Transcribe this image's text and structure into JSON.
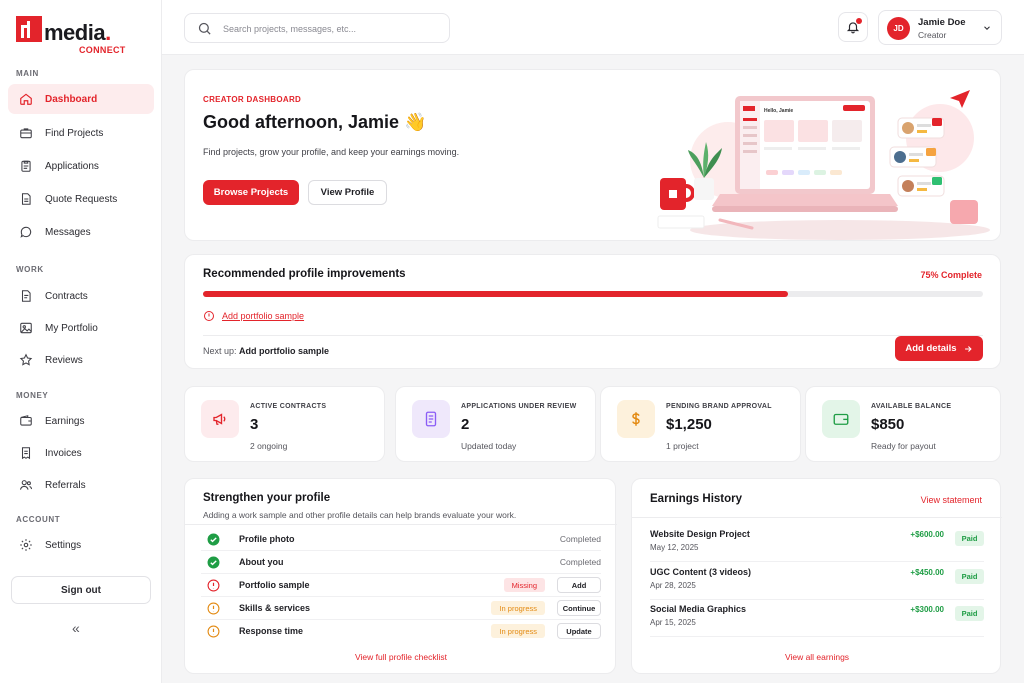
{
  "brand": {
    "name": "media",
    "dot": ".",
    "sub": "CONNECT",
    "accent": "#e3242b"
  },
  "sidebar": {
    "sections": {
      "main": "MAIN",
      "work": "WORK",
      "money": "MONEY",
      "account": "ACCOUNT"
    },
    "items": [
      {
        "label": "Dashboard",
        "icon": "home-icon"
      },
      {
        "label": "Find Projects",
        "icon": "briefcase-icon"
      },
      {
        "label": "Applications",
        "icon": "clipboard-icon"
      },
      {
        "label": "Quote Requests",
        "icon": "document-icon"
      },
      {
        "label": "Messages",
        "icon": "chat-icon"
      },
      {
        "label": "Contracts",
        "icon": "contract-icon"
      },
      {
        "label": "My Portfolio",
        "icon": "image-icon"
      },
      {
        "label": "Reviews",
        "icon": "star-icon"
      },
      {
        "label": "Earnings",
        "icon": "wallet-icon"
      },
      {
        "label": "Invoices",
        "icon": "invoice-icon"
      },
      {
        "label": "Referrals",
        "icon": "users-icon"
      },
      {
        "label": "Settings",
        "icon": "gear-icon"
      }
    ],
    "signout": "Sign out",
    "collapse": "«"
  },
  "header": {
    "search_placeholder": "Search projects, messages, etc...",
    "user": {
      "initials": "JD",
      "name": "Jamie Doe",
      "role": "Creator"
    }
  },
  "hero": {
    "eyebrow": "CREATOR DASHBOARD",
    "greeting": "Good afternoon, Jamie 👋",
    "description": "Find projects, grow your profile, and keep your earnings moving.",
    "primary_button": "Browse Projects",
    "secondary_button": "View Profile",
    "screen_greeting": "Hello, Jamie"
  },
  "improvements": {
    "title": "Recommended profile improvements",
    "percent_label": "75% Complete",
    "progress": 0.75,
    "link": "Add portfolio sample",
    "next_prefix": "Next up:",
    "next_value": "Add portfolio sample",
    "button": "Add details"
  },
  "stats": [
    {
      "label": "ACTIVE CONTRACTS",
      "value": "3",
      "sub": "2 ongoing",
      "icon": "megaphone-icon",
      "bg": "#fdebed",
      "color": "#e3242b"
    },
    {
      "label": "APPLICATIONS UNDER REVIEW",
      "value": "2",
      "sub": "Updated today",
      "icon": "file-list-icon",
      "bg": "#efe8fb",
      "color": "#8b5cf6"
    },
    {
      "label": "PENDING BRAND APPROVAL",
      "value": "$1,250",
      "sub": "1 project",
      "icon": "dollar-icon",
      "bg": "#fdf1dc",
      "color": "#e38a12"
    },
    {
      "label": "AVAILABLE BALANCE",
      "value": "$850",
      "sub": "Ready for payout",
      "icon": "wallet-icon",
      "bg": "#e3f5e8",
      "color": "#1f9d45"
    }
  ],
  "strengthen": {
    "title": "Strengthen your profile",
    "subtitle": "Adding a work sample and other profile details can help brands evaluate your work.",
    "rows": [
      {
        "label": "Profile photo",
        "status": "Completed",
        "state": "done"
      },
      {
        "label": "About you",
        "status": "Completed",
        "state": "done"
      },
      {
        "label": "Portfolio sample",
        "status": "Missing",
        "state": "missing",
        "action": "Add"
      },
      {
        "label": "Skills & services",
        "status": "In progress",
        "state": "progress",
        "action": "Continue"
      },
      {
        "label": "Response time",
        "status": "In progress",
        "state": "progress",
        "action": "Update"
      }
    ],
    "footer": "View full profile checklist"
  },
  "earnings": {
    "title": "Earnings History",
    "link": "View statement",
    "rows": [
      {
        "name": "Website Design Project",
        "date": "May 12, 2025",
        "amount": "+$600.00",
        "status": "Paid"
      },
      {
        "name": "UGC Content (3 videos)",
        "date": "Apr 28, 2025",
        "amount": "+$450.00",
        "status": "Paid"
      },
      {
        "name": "Social Media Graphics",
        "date": "Apr 15, 2025",
        "amount": "+$300.00",
        "status": "Paid"
      }
    ],
    "footer": "View all earnings"
  }
}
